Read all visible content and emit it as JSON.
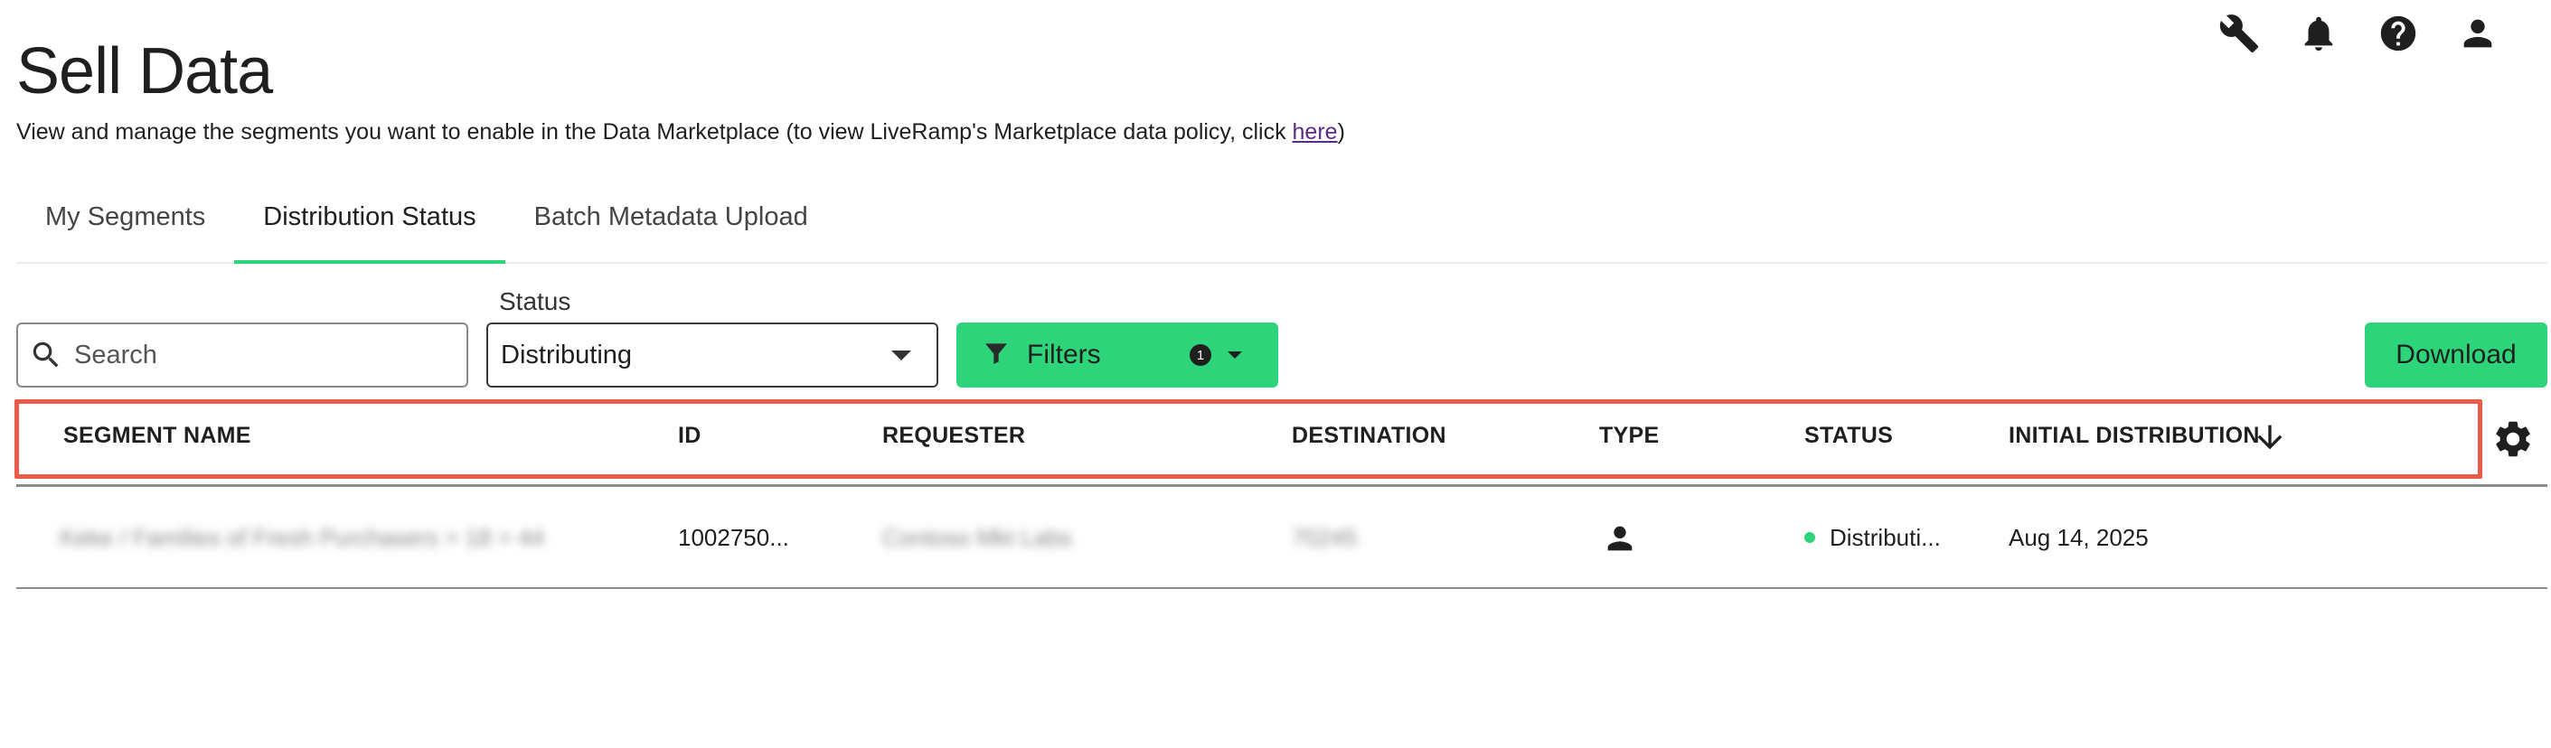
{
  "page": {
    "title": "Sell Data",
    "subtitle_text": "View and manage the segments you want to enable in the Data Marketplace (to view LiveRamp's Marketplace data policy, click ",
    "subtitle_link": "here",
    "subtitle_close": ")"
  },
  "top_icons": [
    "wrench-icon",
    "bell-icon",
    "help-icon",
    "account-icon"
  ],
  "tabs": [
    {
      "label": "My Segments",
      "active": false
    },
    {
      "label": "Distribution Status",
      "active": true
    },
    {
      "label": "Batch Metadata Upload",
      "active": false
    }
  ],
  "controls": {
    "search_placeholder": "Search",
    "status_label": "Status",
    "status_value": "Distributing",
    "filters_label": "Filters",
    "filters_count": "1",
    "download_label": "Download"
  },
  "table": {
    "columns": [
      "SEGMENT NAME",
      "ID",
      "REQUESTER",
      "DESTINATION",
      "TYPE",
      "STATUS",
      "INITIAL DISTRIBUTION"
    ],
    "sort_icon": "arrow-down-icon",
    "settings_icon": "gear-icon",
    "rows": [
      {
        "segment_name": "Keke / Families of Fresh Purchasers > 18 > 44",
        "id": "1002750...",
        "requester": "Contoso Mkt Labs",
        "destination": "70245",
        "type_icon": "person-icon",
        "status": "Distributi...",
        "status_color": "#2ed47a",
        "initial_distribution": "Aug 14, 2025"
      }
    ]
  },
  "colors": {
    "accent": "#2ed47a",
    "highlight_border": "#ea5b4a",
    "link": "#5b2a86"
  }
}
